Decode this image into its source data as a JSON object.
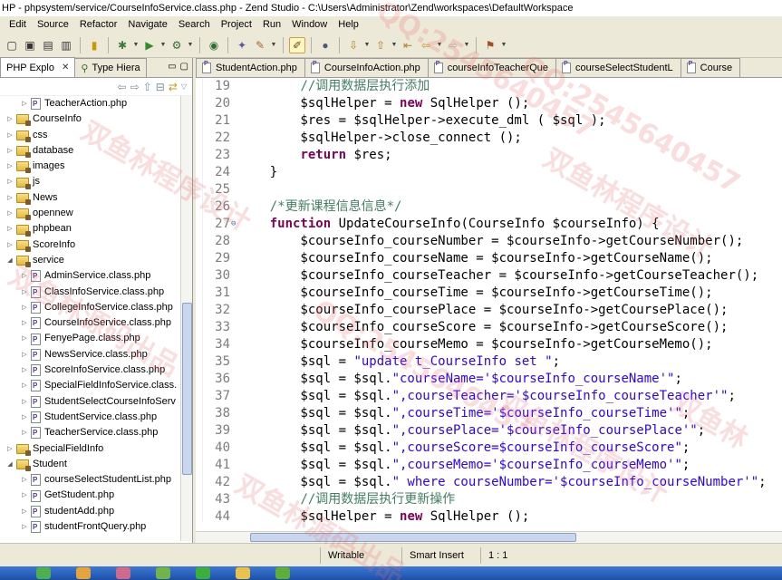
{
  "window": {
    "title": "HP - phpsystem/service/CourseInfoService.class.php - Zend Studio - C:\\Users\\Administrator\\Zend\\workspaces\\DefaultWorkspace"
  },
  "menu": [
    "Edit",
    "Source",
    "Refactor",
    "Navigate",
    "Search",
    "Project",
    "Run",
    "Window",
    "Help"
  ],
  "left_panel": {
    "tabs": [
      {
        "label": "PHP Explo",
        "active": true
      },
      {
        "label": "Type Hiera",
        "active": false
      }
    ],
    "tree": [
      {
        "label": "TeacherAction.php",
        "type": "file",
        "depth": 2
      },
      {
        "label": "CourseInfo",
        "type": "folder",
        "depth": 1
      },
      {
        "label": "css",
        "type": "folder",
        "depth": 1
      },
      {
        "label": "database",
        "type": "folder",
        "depth": 1
      },
      {
        "label": "images",
        "type": "folder",
        "depth": 1
      },
      {
        "label": "js",
        "type": "folder",
        "depth": 1
      },
      {
        "label": "News",
        "type": "folder",
        "depth": 1
      },
      {
        "label": "opennew",
        "type": "folder",
        "depth": 1
      },
      {
        "label": "phpbean",
        "type": "folder",
        "depth": 1
      },
      {
        "label": "ScoreInfo",
        "type": "folder",
        "depth": 1
      },
      {
        "label": "service",
        "type": "folder",
        "depth": 1,
        "expanded": true
      },
      {
        "label": "AdminService.class.php",
        "type": "file",
        "depth": 2
      },
      {
        "label": "ClassInfoService.class.php",
        "type": "file",
        "depth": 2
      },
      {
        "label": "CollegeInfoService.class.php",
        "type": "file",
        "depth": 2
      },
      {
        "label": "CourseInfoService.class.php",
        "type": "file",
        "depth": 2
      },
      {
        "label": "FenyePage.class.php",
        "type": "file",
        "depth": 2
      },
      {
        "label": "NewsService.class.php",
        "type": "file",
        "depth": 2
      },
      {
        "label": "ScoreInfoService.class.php",
        "type": "file",
        "depth": 2
      },
      {
        "label": "SpecialFieldInfoService.class.",
        "type": "file",
        "depth": 2
      },
      {
        "label": "StudentSelectCourseInfoServ",
        "type": "file",
        "depth": 2
      },
      {
        "label": "StudentService.class.php",
        "type": "file",
        "depth": 2
      },
      {
        "label": "TeacherService.class.php",
        "type": "file",
        "depth": 2
      },
      {
        "label": "SpecialFieldInfo",
        "type": "folder",
        "depth": 1
      },
      {
        "label": "Student",
        "type": "folder",
        "depth": 1,
        "expanded": true
      },
      {
        "label": "courseSelectStudentList.php",
        "type": "file",
        "depth": 2
      },
      {
        "label": "GetStudent.php",
        "type": "file",
        "depth": 2
      },
      {
        "label": "studentAdd.php",
        "type": "file",
        "depth": 2
      },
      {
        "label": "studentFrontQuery.php",
        "type": "file",
        "depth": 2
      }
    ]
  },
  "editor": {
    "tabs": [
      {
        "label": "StudentAction.php"
      },
      {
        "label": "CourseInfoAction.php"
      },
      {
        "label": "courseInfoTeacherQue"
      },
      {
        "label": "courseSelectStudentL"
      },
      {
        "label": "Course"
      }
    ],
    "lines": [
      {
        "num": "19",
        "parts": [
          {
            "t": "        ",
            "c": "tx"
          },
          {
            "t": "//调用数据层执行添加",
            "c": "cm"
          }
        ]
      },
      {
        "num": "20",
        "parts": [
          {
            "t": "        $sqlHelper = ",
            "c": "tx"
          },
          {
            "t": "new",
            "c": "kw"
          },
          {
            "t": " SqlHelper ();",
            "c": "tx"
          }
        ]
      },
      {
        "num": "21",
        "parts": [
          {
            "t": "        $res = $sqlHelper->execute_dml ( $sql );",
            "c": "tx"
          }
        ]
      },
      {
        "num": "22",
        "parts": [
          {
            "t": "        $sqlHelper->close_connect ();",
            "c": "tx"
          }
        ]
      },
      {
        "num": "23",
        "parts": [
          {
            "t": "        ",
            "c": "tx"
          },
          {
            "t": "return",
            "c": "kw"
          },
          {
            "t": " $res;",
            "c": "tx"
          }
        ]
      },
      {
        "num": "24",
        "parts": [
          {
            "t": "    }",
            "c": "tx"
          }
        ]
      },
      {
        "num": "25",
        "parts": [
          {
            "t": "",
            "c": "tx"
          }
        ]
      },
      {
        "num": "26",
        "parts": [
          {
            "t": "    ",
            "c": "tx"
          },
          {
            "t": "/*更新课程信息信息*/",
            "c": "cm"
          }
        ]
      },
      {
        "num": "27",
        "fold": true,
        "parts": [
          {
            "t": "    ",
            "c": "tx"
          },
          {
            "t": "function",
            "c": "kw"
          },
          {
            "t": " UpdateCourseInfo(CourseInfo $courseInfo) {",
            "c": "tx"
          }
        ]
      },
      {
        "num": "28",
        "parts": [
          {
            "t": "        $courseInfo_courseNumber = $courseInfo->getCourseNumber();",
            "c": "tx"
          }
        ]
      },
      {
        "num": "29",
        "parts": [
          {
            "t": "        $courseInfo_courseName = $courseInfo->getCourseName();",
            "c": "tx"
          }
        ]
      },
      {
        "num": "30",
        "parts": [
          {
            "t": "        $courseInfo_courseTeacher = $courseInfo->getCourseTeacher();",
            "c": "tx"
          }
        ]
      },
      {
        "num": "31",
        "parts": [
          {
            "t": "        $courseInfo_courseTime = $courseInfo->getCourseTime();",
            "c": "tx"
          }
        ]
      },
      {
        "num": "32",
        "parts": [
          {
            "t": "        $courseInfo_coursePlace = $courseInfo->getCoursePlace();",
            "c": "tx"
          }
        ]
      },
      {
        "num": "33",
        "parts": [
          {
            "t": "        $courseInfo_courseScore = $courseInfo->getCourseScore();",
            "c": "tx"
          }
        ]
      },
      {
        "num": "34",
        "parts": [
          {
            "t": "        $courseInfo_courseMemo = $courseInfo->getCourseMemo();",
            "c": "tx"
          }
        ]
      },
      {
        "num": "35",
        "parts": [
          {
            "t": "        $sql = ",
            "c": "tx"
          },
          {
            "t": "\"update t_CourseInfo set \"",
            "c": "st"
          },
          {
            "t": ";",
            "c": "tx"
          }
        ]
      },
      {
        "num": "36",
        "parts": [
          {
            "t": "        $sql = $sql.",
            "c": "tx"
          },
          {
            "t": "\"courseName='$courseInfo_courseName'\"",
            "c": "st"
          },
          {
            "t": ";",
            "c": "tx"
          }
        ]
      },
      {
        "num": "37",
        "parts": [
          {
            "t": "        $sql = $sql.",
            "c": "tx"
          },
          {
            "t": "\",courseTeacher='$courseInfo_courseTeacher'\"",
            "c": "st"
          },
          {
            "t": ";",
            "c": "tx"
          }
        ]
      },
      {
        "num": "38",
        "parts": [
          {
            "t": "        $sql = $sql.",
            "c": "tx"
          },
          {
            "t": "\",courseTime='$courseInfo_courseTime'\"",
            "c": "st"
          },
          {
            "t": ";",
            "c": "tx"
          }
        ]
      },
      {
        "num": "39",
        "parts": [
          {
            "t": "        $sql = $sql.",
            "c": "tx"
          },
          {
            "t": "\",coursePlace='$courseInfo_coursePlace'\"",
            "c": "st"
          },
          {
            "t": ";",
            "c": "tx"
          }
        ]
      },
      {
        "num": "40",
        "parts": [
          {
            "t": "        $sql = $sql.",
            "c": "tx"
          },
          {
            "t": "\",courseScore=$courseInfo_courseScore\"",
            "c": "st"
          },
          {
            "t": ";",
            "c": "tx"
          }
        ]
      },
      {
        "num": "41",
        "parts": [
          {
            "t": "        $sql = $sql.",
            "c": "tx"
          },
          {
            "t": "\",courseMemo='$courseInfo_courseMemo'\"",
            "c": "st"
          },
          {
            "t": ";",
            "c": "tx"
          }
        ]
      },
      {
        "num": "42",
        "parts": [
          {
            "t": "        $sql = $sql.",
            "c": "tx"
          },
          {
            "t": "\" where courseNumber='$courseInfo_courseNumber'\"",
            "c": "st"
          },
          {
            "t": ";",
            "c": "tx"
          }
        ]
      },
      {
        "num": "43",
        "parts": [
          {
            "t": "        ",
            "c": "tx"
          },
          {
            "t": "//调用数据层执行更新操作",
            "c": "cm"
          }
        ]
      },
      {
        "num": "44",
        "parts": [
          {
            "t": "        $sqlHelper = ",
            "c": "tx"
          },
          {
            "t": "new",
            "c": "kw"
          },
          {
            "t": " SqlHelper ();",
            "c": "tx"
          }
        ]
      }
    ]
  },
  "status": {
    "mode": "Writable",
    "insert": "Smart Insert",
    "position": "1 : 1"
  },
  "watermarks": [
    "QQ:2545640457",
    "QQ:2545640457",
    "QQ:2545640457",
    "双鱼林程序设计",
    "双鱼林程序设计",
    "双鱼林源码出品",
    "双鱼林源码出品",
    "双鱼林",
    "双鱼林程序设计"
  ],
  "colors": {
    "keyword": "#7f0055",
    "comment": "#3f7f5f",
    "string": "#2a00ff",
    "line_number": "#7d7d7d"
  }
}
